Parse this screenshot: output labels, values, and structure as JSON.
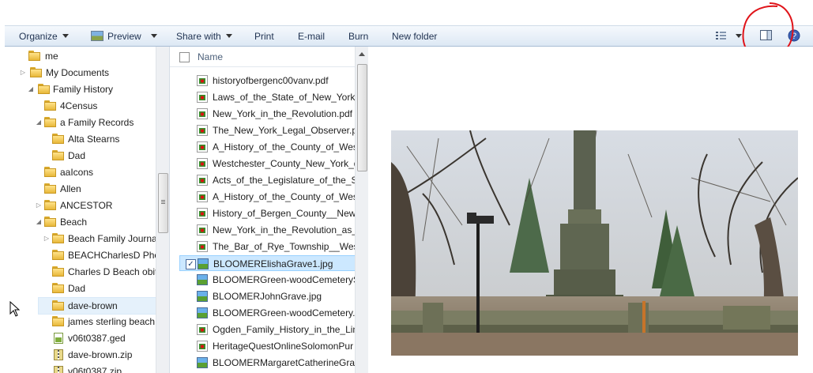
{
  "toolbar": {
    "organize": "Organize",
    "preview": "Preview",
    "share_with": "Share with",
    "print": "Print",
    "email": "E-mail",
    "burn": "Burn",
    "new_folder": "New folder"
  },
  "nav": {
    "items": [
      {
        "label": "me",
        "type": "folder"
      },
      {
        "label": "My Documents",
        "type": "folder"
      },
      {
        "label": "Family History",
        "type": "folder"
      },
      {
        "label": "4Census",
        "type": "folder"
      },
      {
        "label": "a Family Records",
        "type": "folder"
      },
      {
        "label": "Alta Stearns",
        "type": "folder"
      },
      {
        "label": "Dad",
        "type": "folder"
      },
      {
        "label": "aaIcons",
        "type": "folder"
      },
      {
        "label": "Allen",
        "type": "folder"
      },
      {
        "label": "ANCESTOR",
        "type": "folder"
      },
      {
        "label": "Beach",
        "type": "folder"
      },
      {
        "label": "Beach Family Journa",
        "type": "folder"
      },
      {
        "label": "BEACHCharlesD Pho",
        "type": "folder"
      },
      {
        "label": "Charles D Beach obit",
        "type": "folder"
      },
      {
        "label": "Dad",
        "type": "folder"
      },
      {
        "label": "dave-brown",
        "type": "folder"
      },
      {
        "label": "james sterling beach",
        "type": "folder"
      },
      {
        "label": "v06t0387.ged",
        "type": "file"
      },
      {
        "label": "dave-brown.zip",
        "type": "zip"
      },
      {
        "label": "v06t0387.zip",
        "type": "zip"
      }
    ]
  },
  "files": {
    "column_name": "Name",
    "items": [
      {
        "name": "historyofbergenc00vanv.pdf",
        "type": "pdf"
      },
      {
        "name": "Laws_of_the_State_of_New_York.p",
        "type": "pdf"
      },
      {
        "name": "New_York_in_the_Revolution.pdf",
        "type": "pdf"
      },
      {
        "name": "The_New_York_Legal_Observer.pd",
        "type": "pdf"
      },
      {
        "name": "A_History_of_the_County_of_West",
        "type": "pdf"
      },
      {
        "name": "Westchester_County_New_York_d",
        "type": "pdf"
      },
      {
        "name": "Acts_of_the_Legislature_of_the_Sta",
        "type": "pdf"
      },
      {
        "name": "A_History_of_the_County_of_West",
        "type": "pdf"
      },
      {
        "name": "History_of_Bergen_County__New_",
        "type": "pdf"
      },
      {
        "name": "New_York_in_the_Revolution_as_C",
        "type": "pdf"
      },
      {
        "name": "The_Bar_of_Rye_Township__Westc",
        "type": "pdf"
      },
      {
        "name": "BLOOMERElishaGrave1.jpg",
        "type": "jpg"
      },
      {
        "name": "BLOOMERGreen-woodCemeteryS",
        "type": "jpg"
      },
      {
        "name": "BLOOMERJohnGrave.jpg",
        "type": "jpg"
      },
      {
        "name": "BLOOMERGreen-woodCemetery.j",
        "type": "jpg"
      },
      {
        "name": "Ogden_Family_History_in_the_Line",
        "type": "pdf"
      },
      {
        "name": "HeritageQuestOnlineSolomonPur",
        "type": "pdf"
      },
      {
        "name": "BLOOMERMargaretCatherineGrav",
        "type": "jpg"
      }
    ]
  }
}
